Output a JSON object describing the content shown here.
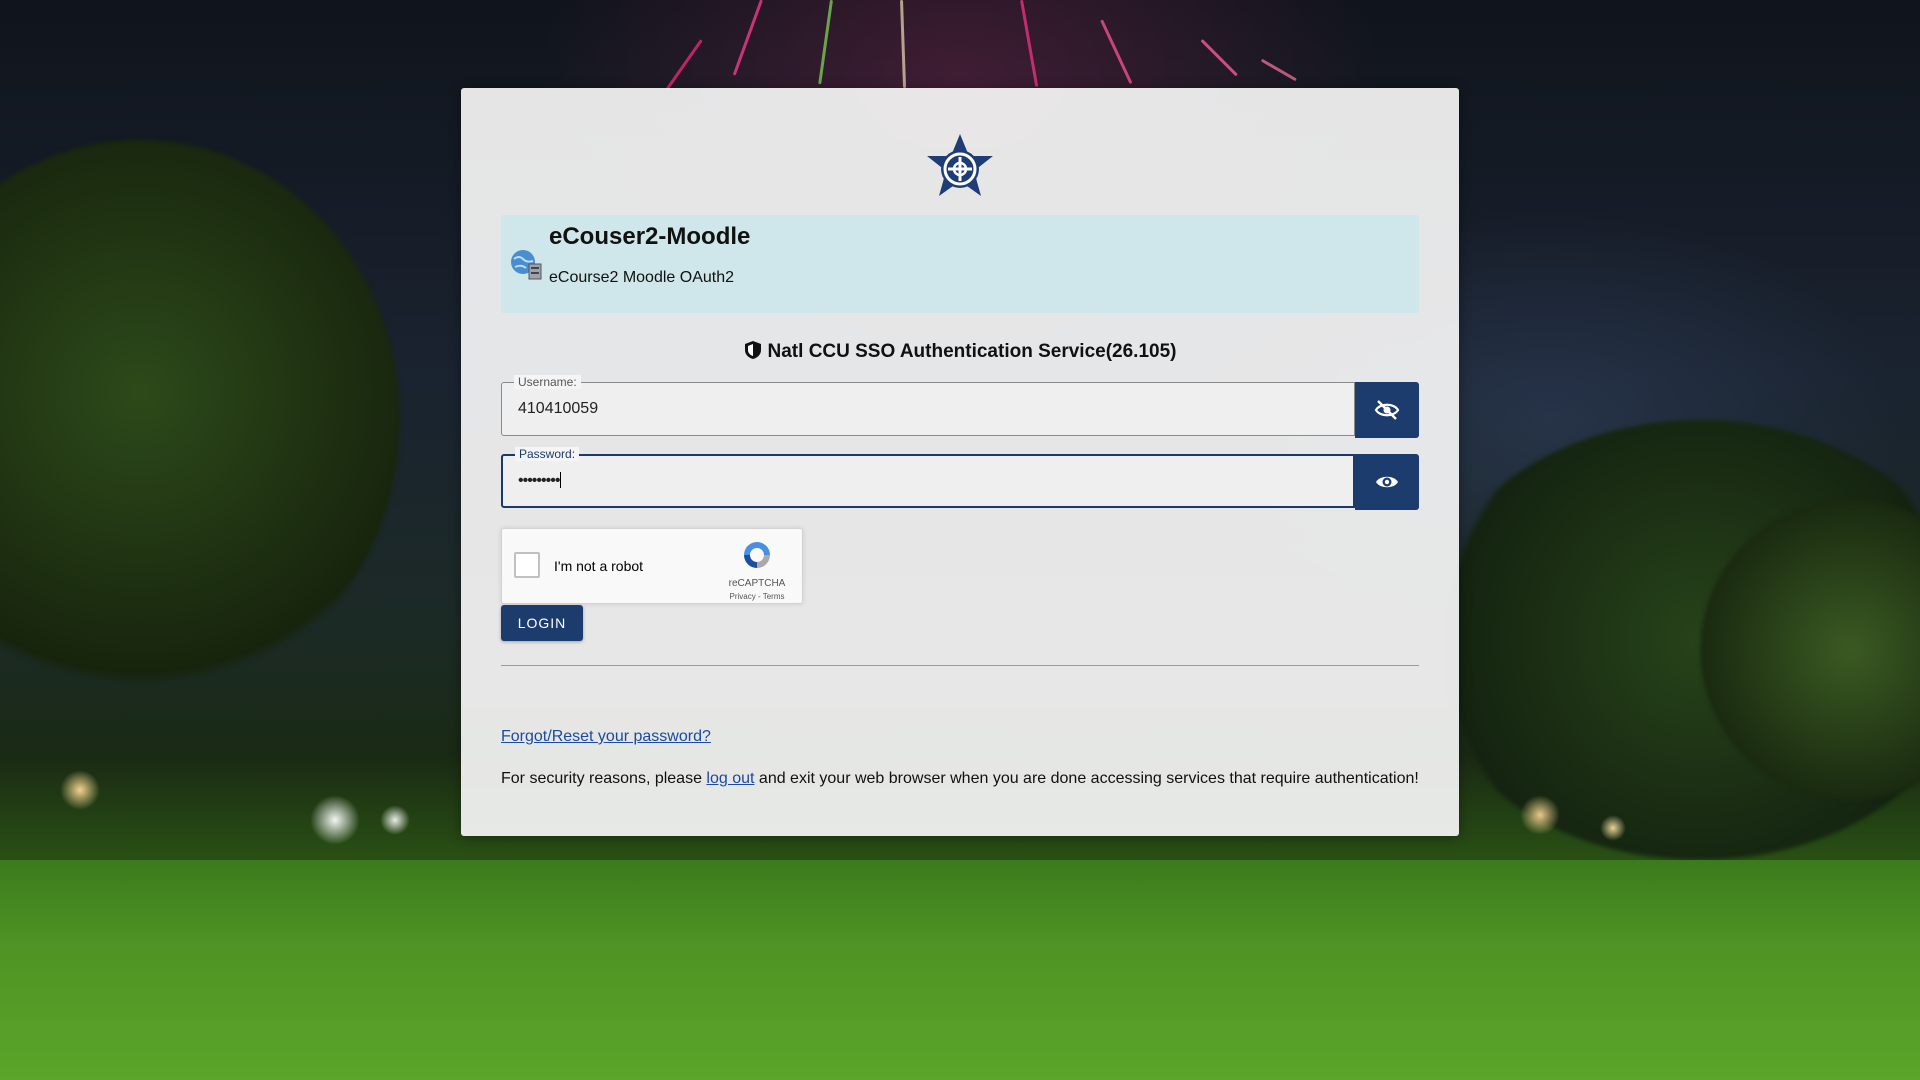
{
  "service": {
    "title": "eCouser2-Moodle",
    "subtitle": "eCourse2 Moodle OAuth2",
    "icon": "globe-server-icon"
  },
  "auth": {
    "heading": "Natl CCU SSO Authentication Service(26.105)",
    "heading_icon": "shield-icon"
  },
  "username": {
    "label": "Username:",
    "value": "410410059",
    "toggle_icon": "eye-off-icon"
  },
  "password": {
    "label": "Password:",
    "value": "•••••••••",
    "toggle_icon": "eye-icon"
  },
  "recaptcha": {
    "label": "I'm not a robot",
    "brand": "reCAPTCHA",
    "privacy": "Privacy",
    "separator": " - ",
    "terms": "Terms"
  },
  "login_label": "LOGIN",
  "forgot_link": "Forgot/Reset your password?",
  "security": {
    "prefix": "For security reasons, please ",
    "logout_link": "log out",
    "suffix": " and exit your web browser when you are done accessing services that require authentication!"
  },
  "colors": {
    "primary": "#1d3c6e",
    "service_box": "#cfe7ea",
    "link": "#1a4ba0"
  }
}
